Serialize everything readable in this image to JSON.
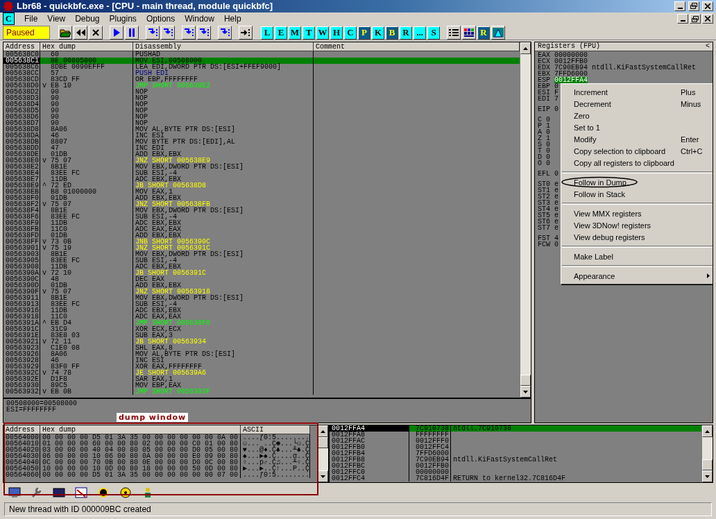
{
  "window": {
    "title": "Lbr68 - quickbfc.exe - [CPU - main thread, module quickbfc]"
  },
  "menu": {
    "app_letter": "C",
    "items": [
      "File",
      "View",
      "Debug",
      "Plugins",
      "Options",
      "Window",
      "Help"
    ]
  },
  "toolbar": {
    "status": "Paused",
    "letters": [
      {
        "label": "L",
        "highlighted": false
      },
      {
        "label": "E",
        "highlighted": false
      },
      {
        "label": "M",
        "highlighted": false
      },
      {
        "label": "T",
        "highlighted": false
      },
      {
        "label": "W",
        "highlighted": false
      },
      {
        "label": "H",
        "highlighted": false
      },
      {
        "label": "C",
        "highlighted": false
      },
      {
        "label": "P",
        "highlighted": true
      },
      {
        "label": "K",
        "highlighted": false
      },
      {
        "label": "B",
        "highlighted": true
      },
      {
        "label": "R",
        "highlighted": false
      },
      {
        "label": "...",
        "highlighted": false
      },
      {
        "label": "S",
        "highlighted": false
      }
    ],
    "view_buttons": [
      "R"
    ]
  },
  "disassembly": {
    "columns": [
      "Address",
      "Hex dump",
      "Disassembly",
      "Comment"
    ],
    "rows": [
      {
        "address": "005638C0",
        "hex": "60",
        "code": "PUSHAD",
        "kind": "plain",
        "selected": false
      },
      {
        "address": "005638C1",
        "hex": "BE 00805000",
        "code": "MOV ESI,00508000",
        "kind": "plain",
        "selected": true
      },
      {
        "address": "005638C6",
        "hex": "8DBE 0090EFFF",
        "code": "LEA EDI,DWORD PTR DS:[ESI+FFEF9000]",
        "kind": "plain",
        "selected": false
      },
      {
        "address": "005638CC",
        "hex": "57",
        "code": "PUSH EDI",
        "kind": "stack",
        "selected": false
      },
      {
        "address": "005638CD",
        "hex": "83CD FF",
        "code": "OR EBP,FFFFFFFF",
        "kind": "plain",
        "selected": false
      },
      {
        "address": "005638D0",
        "arrow": "v",
        "hex": "EB 10",
        "code": "JMP SHORT 005638E2",
        "kind": "jump",
        "selected": false
      },
      {
        "address": "005638D2",
        "hex": "90",
        "code": "NOP",
        "kind": "plain",
        "selected": false
      },
      {
        "address": "005638D3",
        "hex": "90",
        "code": "NOP",
        "kind": "plain",
        "selected": false
      },
      {
        "address": "005638D4",
        "hex": "90",
        "code": "NOP",
        "kind": "plain",
        "selected": false
      },
      {
        "address": "005638D5",
        "hex": "90",
        "code": "NOP",
        "kind": "plain",
        "selected": false
      },
      {
        "address": "005638D6",
        "hex": "90",
        "code": "NOP",
        "kind": "plain",
        "selected": false
      },
      {
        "address": "005638D7",
        "hex": "90",
        "code": "NOP",
        "kind": "plain",
        "selected": false
      },
      {
        "address": "005638D8",
        "hex": "8A06",
        "code": "MOV AL,BYTE PTR DS:[ESI]",
        "kind": "plain",
        "selected": false
      },
      {
        "address": "005638DA",
        "hex": "46",
        "code": "INC ESI",
        "kind": "plain",
        "selected": false
      },
      {
        "address": "005638DB",
        "hex": "8807",
        "code": "MOV BYTE PTR DS:[EDI],AL",
        "kind": "plain",
        "selected": false
      },
      {
        "address": "005638DD",
        "hex": "47",
        "code": "INC EDI",
        "kind": "plain",
        "selected": false
      },
      {
        "address": "005638DE",
        "hex": "01DB",
        "code": "ADD EBX,EBX",
        "kind": "plain",
        "selected": false
      },
      {
        "address": "005638E0",
        "arrow": "v",
        "hex": "75 07",
        "code": "JNZ SHORT 005638E9",
        "kind": "branch",
        "selected": false
      },
      {
        "address": "005638E2",
        "hex": "8B1E",
        "code": "MOV EBX,DWORD PTR DS:[ESI]",
        "kind": "plain",
        "selected": false
      },
      {
        "address": "005638E4",
        "hex": "83EE FC",
        "code": "SUB ESI,-4",
        "kind": "plain",
        "selected": false
      },
      {
        "address": "005638E7",
        "hex": "11DB",
        "code": "ADC EBX,EBX",
        "kind": "plain",
        "selected": false
      },
      {
        "address": "005638E9",
        "arrow": "^",
        "hex": "72 ED",
        "code": "JB SHORT 005638D8",
        "kind": "branch",
        "selected": false
      },
      {
        "address": "005638EB",
        "hex": "B8 01000000",
        "code": "MOV EAX,1",
        "kind": "plain",
        "selected": false
      },
      {
        "address": "005638F0",
        "hex": "01DB",
        "code": "ADD EBX,EBX",
        "kind": "plain",
        "selected": false
      },
      {
        "address": "005638F2",
        "arrow": "v",
        "hex": "75 07",
        "code": "JNZ SHORT 005638FB",
        "kind": "branch",
        "selected": false
      },
      {
        "address": "005638F4",
        "hex": "8B1E",
        "code": "MOV EBX,DWORD PTR DS:[ESI]",
        "kind": "plain",
        "selected": false
      },
      {
        "address": "005638F6",
        "hex": "83EE FC",
        "code": "SUB ESI,-4",
        "kind": "plain",
        "selected": false
      },
      {
        "address": "005638F9",
        "hex": "11DB",
        "code": "ADC EBX,EBX",
        "kind": "plain",
        "selected": false
      },
      {
        "address": "005638FB",
        "hex": "11C0",
        "code": "ADC EAX,EAX",
        "kind": "plain",
        "selected": false
      },
      {
        "address": "005638FD",
        "hex": "01DB",
        "code": "ADD EBX,EBX",
        "kind": "plain",
        "selected": false
      },
      {
        "address": "005638FF",
        "arrow": "v",
        "hex": "73 0B",
        "code": "JNB SHORT 0056390C",
        "kind": "branch",
        "selected": false
      },
      {
        "address": "00563901",
        "arrow": "v",
        "hex": "75 19",
        "code": "JNZ SHORT 0056391C",
        "kind": "branch",
        "selected": false
      },
      {
        "address": "00563903",
        "hex": "8B1E",
        "code": "MOV EBX,DWORD PTR DS:[ESI]",
        "kind": "plain",
        "selected": false
      },
      {
        "address": "00563905",
        "hex": "83EE FC",
        "code": "SUB ESI,-4",
        "kind": "plain",
        "selected": false
      },
      {
        "address": "00563908",
        "hex": "11DB",
        "code": "ADC EBX,EBX",
        "kind": "plain",
        "selected": false
      },
      {
        "address": "0056390A",
        "arrow": "v",
        "hex": "72 10",
        "code": "JB SHORT 0056391C",
        "kind": "branch",
        "selected": false
      },
      {
        "address": "0056390C",
        "hex": "48",
        "code": "DEC EAX",
        "kind": "plain",
        "selected": false
      },
      {
        "address": "0056390D",
        "hex": "01DB",
        "code": "ADD EBX,EBX",
        "kind": "plain",
        "selected": false
      },
      {
        "address": "0056390F",
        "arrow": "v",
        "hex": "75 07",
        "code": "JNZ SHORT 00563918",
        "kind": "branch",
        "selected": false
      },
      {
        "address": "00563911",
        "hex": "8B1E",
        "code": "MOV EBX,DWORD PTR DS:[ESI]",
        "kind": "plain",
        "selected": false
      },
      {
        "address": "00563913",
        "hex": "83EE FC",
        "code": "SUB ESI,-4",
        "kind": "plain",
        "selected": false
      },
      {
        "address": "00563916",
        "hex": "11DB",
        "code": "ADC EBX,EBX",
        "kind": "plain",
        "selected": false
      },
      {
        "address": "00563918",
        "hex": "11C0",
        "code": "ADC EAX,EAX",
        "kind": "plain",
        "selected": false
      },
      {
        "address": "0056391A",
        "arrow": "^",
        "hex": "EB D4",
        "code": "JMP SHORT 005638F0",
        "kind": "jump",
        "selected": false
      },
      {
        "address": "0056391C",
        "hex": "31C9",
        "code": "XOR ECX,ECX",
        "kind": "plain",
        "selected": false
      },
      {
        "address": "0056391E",
        "hex": "83E8 03",
        "code": "SUB EAX,3",
        "kind": "plain",
        "selected": false
      },
      {
        "address": "00563921",
        "arrow": "v",
        "hex": "72 11",
        "code": "JB SHORT 00563934",
        "kind": "branch",
        "selected": false
      },
      {
        "address": "00563923",
        "hex": "C1E0 08",
        "code": "SHL EAX,8",
        "kind": "plain",
        "selected": false
      },
      {
        "address": "00563926",
        "hex": "8A06",
        "code": "MOV AL,BYTE PTR DS:[ESI]",
        "kind": "plain",
        "selected": false
      },
      {
        "address": "00563928",
        "hex": "46",
        "code": "INC ESI",
        "kind": "plain",
        "selected": false
      },
      {
        "address": "00563929",
        "hex": "83F0 FF",
        "code": "XOR EAX,FFFFFFFF",
        "kind": "plain",
        "selected": false
      },
      {
        "address": "0056392C",
        "arrow": "v",
        "hex": "74 78",
        "code": "JE SHORT 005639A6",
        "kind": "branch",
        "selected": false
      },
      {
        "address": "0056392E",
        "hex": "D1F8",
        "code": "SAR EAX,1",
        "kind": "plain",
        "selected": false
      },
      {
        "address": "00563930",
        "hex": "89C5",
        "code": "MOV EBP,EAX",
        "kind": "plain",
        "selected": false
      },
      {
        "address": "00563932",
        "arrow": "v",
        "hex": "EB 0B",
        "code": "JMP SHORT 0056393F",
        "kind": "jump",
        "selected": false
      }
    ]
  },
  "info": [
    "00508000=00508000",
    "ESI=FFFFFFFF"
  ],
  "registers": {
    "title": "Registers (FPU)",
    "header_button": "<",
    "lines": [
      {
        "kind": "reg",
        "name": "EAX",
        "value": "00000000",
        "selected": false
      },
      {
        "kind": "reg",
        "name": "ECX",
        "value": "0012FFB0",
        "selected": false
      },
      {
        "kind": "reg",
        "name": "EDX",
        "value": "7C90EB94",
        "comment": "ntdll.KiFastSystemCallRet",
        "selected": false
      },
      {
        "kind": "reg",
        "name": "EBX",
        "value": "7FFD6000",
        "selected": false
      },
      {
        "kind": "reg",
        "name": "ESP",
        "value": "0012FFA4",
        "selected": true
      },
      {
        "kind": "reg",
        "name": "EBP",
        "value": "0",
        "selected": false
      },
      {
        "kind": "reg",
        "name": "ESI",
        "value": "F",
        "selected": false
      },
      {
        "kind": "reg",
        "name": "EDI",
        "value": "7",
        "selected": false
      },
      {
        "kind": "gap"
      },
      {
        "kind": "reg",
        "name": "EIP",
        "value": "0",
        "selected": false
      },
      {
        "kind": "gap"
      },
      {
        "kind": "reg",
        "name": "C",
        "value": "0",
        "selected": false
      },
      {
        "kind": "reg",
        "name": "P",
        "value": "1",
        "selected": false
      },
      {
        "kind": "reg",
        "name": "A",
        "value": "0",
        "selected": false
      },
      {
        "kind": "reg",
        "name": "Z",
        "value": "1",
        "selected": false
      },
      {
        "kind": "reg",
        "name": "S",
        "value": "0",
        "selected": false
      },
      {
        "kind": "reg",
        "name": "T",
        "value": "0",
        "selected": false
      },
      {
        "kind": "reg",
        "name": "D",
        "value": "0",
        "selected": false
      },
      {
        "kind": "reg",
        "name": "O",
        "value": "0",
        "selected": false
      },
      {
        "kind": "gap"
      },
      {
        "kind": "reg",
        "name": "EFL",
        "value": "0",
        "selected": false
      },
      {
        "kind": "gap"
      },
      {
        "kind": "reg",
        "name": "ST0",
        "value": "e",
        "selected": false
      },
      {
        "kind": "reg",
        "name": "ST1",
        "value": "e",
        "selected": false
      },
      {
        "kind": "reg",
        "name": "ST2",
        "value": "e",
        "selected": false
      },
      {
        "kind": "reg",
        "name": "ST3",
        "value": "e",
        "selected": false
      },
      {
        "kind": "reg",
        "name": "ST4",
        "value": "e",
        "selected": false
      },
      {
        "kind": "reg",
        "name": "ST5",
        "value": "e",
        "selected": false
      },
      {
        "kind": "reg",
        "name": "ST6",
        "value": "e",
        "selected": false
      },
      {
        "kind": "reg",
        "name": "ST7",
        "value": "e",
        "selected": false
      },
      {
        "kind": "gap"
      },
      {
        "kind": "reg",
        "name": "FST",
        "value": "4",
        "selected": false
      },
      {
        "kind": "reg",
        "name": "FCW",
        "value": "0",
        "selected": false
      }
    ]
  },
  "context_menu": {
    "items": [
      {
        "kind": "item",
        "label": "Increment",
        "shortcut": "Plus",
        "circled": false
      },
      {
        "kind": "item",
        "label": "Decrement",
        "shortcut": "Minus",
        "circled": false
      },
      {
        "kind": "item",
        "label": "Zero",
        "circled": false
      },
      {
        "kind": "item",
        "label": "Set to 1",
        "circled": false
      },
      {
        "kind": "item",
        "label": "Modify",
        "shortcut": "Enter",
        "circled": false
      },
      {
        "kind": "item",
        "label": "Copy selection to clipboard",
        "shortcut": "Ctrl+C",
        "circled": false
      },
      {
        "kind": "item",
        "label": "Copy all registers to clipboard",
        "circled": false
      },
      {
        "kind": "separator"
      },
      {
        "kind": "item",
        "label": "Follow in Dump",
        "circled": true
      },
      {
        "kind": "item",
        "label": "Follow in Stack",
        "circled": false
      },
      {
        "kind": "separator"
      },
      {
        "kind": "item",
        "label": "View MMX registers",
        "circled": false
      },
      {
        "kind": "item",
        "label": "View 3DNow! registers",
        "circled": false
      },
      {
        "kind": "item",
        "label": "View debug registers",
        "circled": false
      },
      {
        "kind": "separator"
      },
      {
        "kind": "item",
        "label": "Make Label",
        "circled": false
      },
      {
        "kind": "separator"
      },
      {
        "kind": "submenu",
        "label": "Appearance",
        "circled": false
      }
    ]
  },
  "annotation": {
    "label": "dump window"
  },
  "dump": {
    "columns": [
      "Address",
      "Hex dump",
      "ASCII"
    ],
    "rows": [
      {
        "address": "00564000",
        "hex": "00 00 00 00 D5 01 3A 35 00 00 00 00 00 00 0A 00",
        "ascii": "....ƒ0:5........"
      },
      {
        "address": "00564010",
        "hex": "01 00 00 00 60 00 00 80 02 00 00 00 C0 01 00 80",
        "ascii": "☺...`..Ç☻...└☺.Ç"
      },
      {
        "address": "00564020",
        "hex": "03 00 00 00 40 04 00 80 05 00 00 00 D0 05 00 80",
        "ascii": "♥...@♦.Ç♣...╨♣.Ç"
      },
      {
        "address": "00564030",
        "hex": "06 00 00 00 10 06 00 80 0A 00 00 00 E0 09 00 80",
        "ascii": "♠...►♠.Ç....α..Ç"
      },
      {
        "address": "00564040",
        "hex": "0C 00 00 00 70 0B 00 80 0E 00 00 00 D0 0C 00 80",
        "ascii": "♀...p♂.Ç♫...╨♀.Ç"
      },
      {
        "address": "00564050",
        "hex": "10 00 00 00 10 0D 00 80 18 00 00 00 50 0D 00 80",
        "ascii": "►...►..Ç↑...P..Ç"
      },
      {
        "address": "00564060",
        "hex": "00 00 00 00 D5 01 3A 35 00 00 00 00 00 00 07 00",
        "ascii": "....ƒ0:5........"
      }
    ]
  },
  "stack": {
    "rows": [
      {
        "address": "0012FFA4",
        "value": "7C910738",
        "comment": "ntdll.7C910738",
        "selected": true
      },
      {
        "address": "0012FFA8",
        "value": "FFFFFFFF",
        "selected": false
      },
      {
        "address": "0012FFAC",
        "value": "0012FFF0",
        "selected": false
      },
      {
        "address": "0012FFB0",
        "value": "0012FFC4",
        "selected": false
      },
      {
        "address": "0012FFB4",
        "value": "7FFD6000",
        "selected": false
      },
      {
        "address": "0012FFB8",
        "value": "7C90EB94",
        "comment": "ntdll.KiFastSystemCallRet",
        "selected": false
      },
      {
        "address": "0012FFBC",
        "value": "0012FFB0",
        "selected": false
      },
      {
        "address": "0012FFC0",
        "value": "00000000",
        "selected": false
      },
      {
        "address": "0012FFC4",
        "value": "7C816D4F",
        "comment": "RETURN to kernel32.7C816D4F",
        "selected": false
      }
    ]
  },
  "status_bar": "New thread with ID 000009BC created"
}
